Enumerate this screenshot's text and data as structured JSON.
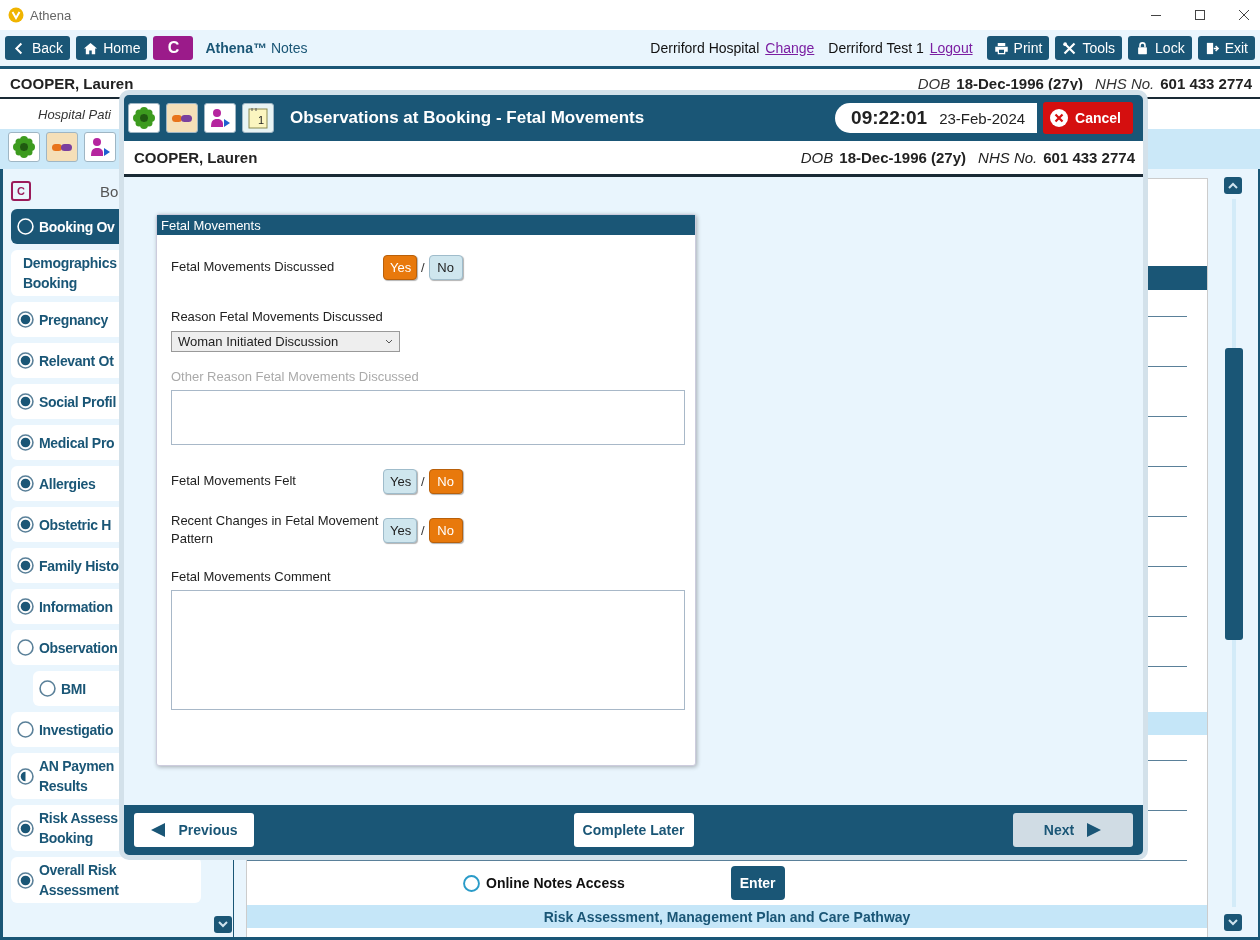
{
  "window": {
    "title": "Athena"
  },
  "toolbar": {
    "left_buttons": [
      {
        "label": "Back",
        "kind": "back"
      },
      {
        "label": "Home",
        "kind": "home"
      }
    ],
    "c_button": "C",
    "app_name": "Athena™",
    "app_subtitle": "Notes",
    "hospital": "Derriford Hospital",
    "hospital_link": "Change",
    "user": "Derriford Test 1",
    "user_link": "Logout",
    "right_buttons": [
      {
        "label": "Print",
        "kind": "print"
      },
      {
        "label": "Tools",
        "kind": "tools"
      },
      {
        "label": "Lock",
        "kind": "lock"
      },
      {
        "label": "Exit",
        "kind": "exit"
      }
    ]
  },
  "patient": {
    "name": "COOPER, Lauren",
    "dob_label": "DOB",
    "dob": "18-Dec-1996 (27y)",
    "nhs_label": "NHS No.",
    "nhs": "601 433 2774"
  },
  "patient_subbar": {
    "text": "Hospital Pati",
    "quick_icons": [
      {
        "kind": "flower"
      },
      {
        "kind": "pill"
      },
      {
        "kind": "person"
      }
    ]
  },
  "sidebar": {
    "badge": "C",
    "header": "Bo",
    "items": [
      {
        "label": [
          "Booking Ov"
        ],
        "kind": "empty",
        "selected": true
      },
      {
        "label": [
          "Demographics",
          "Booking"
        ],
        "kind": "plain",
        "selected": false
      },
      {
        "label": [
          "Pregnancy"
        ],
        "kind": "complete",
        "selected": false
      },
      {
        "label": [
          "Relevant Ot"
        ],
        "kind": "complete",
        "selected": false
      },
      {
        "label": [
          "Social Profil"
        ],
        "kind": "complete",
        "selected": false
      },
      {
        "label": [
          "Medical Pro"
        ],
        "kind": "complete",
        "selected": false
      },
      {
        "label": [
          "Allergies"
        ],
        "kind": "complete",
        "selected": false
      },
      {
        "label": [
          "Obstetric H"
        ],
        "kind": "complete",
        "selected": false
      },
      {
        "label": [
          "Family Histo"
        ],
        "kind": "complete",
        "selected": false
      },
      {
        "label": [
          "Information"
        ],
        "kind": "complete",
        "selected": false
      },
      {
        "label": [
          "Observation"
        ],
        "kind": "empty",
        "selected": false,
        "children": [
          {
            "label": [
              "BMI"
            ],
            "kind": "empty",
            "selected": false
          }
        ]
      },
      {
        "label": [
          "Investigatio"
        ],
        "kind": "empty",
        "selected": false
      },
      {
        "label": [
          "AN Paymen",
          "Results"
        ],
        "kind": "partial",
        "selected": false
      },
      {
        "label": [
          "Risk Assess",
          "Booking"
        ],
        "kind": "complete",
        "selected": false
      },
      {
        "label": [
          "Overall Risk",
          "Assessment"
        ],
        "kind": "complete",
        "selected": false
      }
    ]
  },
  "content": {
    "online_notes": {
      "label": "Online Notes Access",
      "selected": false
    },
    "enter_button": "Enter",
    "section_band": "Risk Assessment, Management Plan and Care Pathway"
  },
  "modal": {
    "header_icons": [
      {
        "kind": "flower"
      },
      {
        "kind": "pill"
      },
      {
        "kind": "person"
      },
      {
        "kind": "calendar",
        "text": "1"
      }
    ],
    "title": "Observations at Booking - Fetal Movements",
    "time": "09:22:01",
    "date": "23-Feb-2024",
    "cancel": "Cancel",
    "patient": {
      "name": "COOPER, Lauren",
      "dob_label": "DOB",
      "dob": "18-Dec-1996 (27y)",
      "nhs_label": "NHS No.",
      "nhs": "601 433 2774"
    },
    "form": {
      "title": "Fetal Movements",
      "fields": [
        {
          "kind": "yesno",
          "label": "Fetal Movements Discussed",
          "separator": "/",
          "options": [
            {
              "label": "Yes",
              "selected": true
            },
            {
              "label": "No",
              "selected": false
            }
          ]
        },
        {
          "kind": "select",
          "label": "Reason Fetal Movements Discussed",
          "value": "Woman Initiated Discussion"
        },
        {
          "kind": "textarea",
          "label": "Other Reason Fetal Movements Discussed",
          "disabled": true
        },
        {
          "kind": "yesno",
          "label": "Fetal Movements Felt",
          "separator": "/",
          "options": [
            {
              "label": "Yes",
              "selected": false
            },
            {
              "label": "No",
              "selected": true
            }
          ]
        },
        {
          "kind": "yesno",
          "label": "Recent Changes in Fetal Movement Pattern",
          "separator": "/",
          "options": [
            {
              "label": "Yes",
              "selected": false
            },
            {
              "label": "No",
              "selected": true
            }
          ]
        },
        {
          "kind": "textarea",
          "label": "Fetal Movements Comment",
          "disabled": false
        }
      ]
    },
    "footer": [
      {
        "kind": "previous",
        "label": "Previous",
        "disabled": false
      },
      {
        "kind": "later",
        "label": "Complete Later",
        "disabled": false
      },
      {
        "kind": "next",
        "label": "Next",
        "disabled": true
      }
    ]
  }
}
